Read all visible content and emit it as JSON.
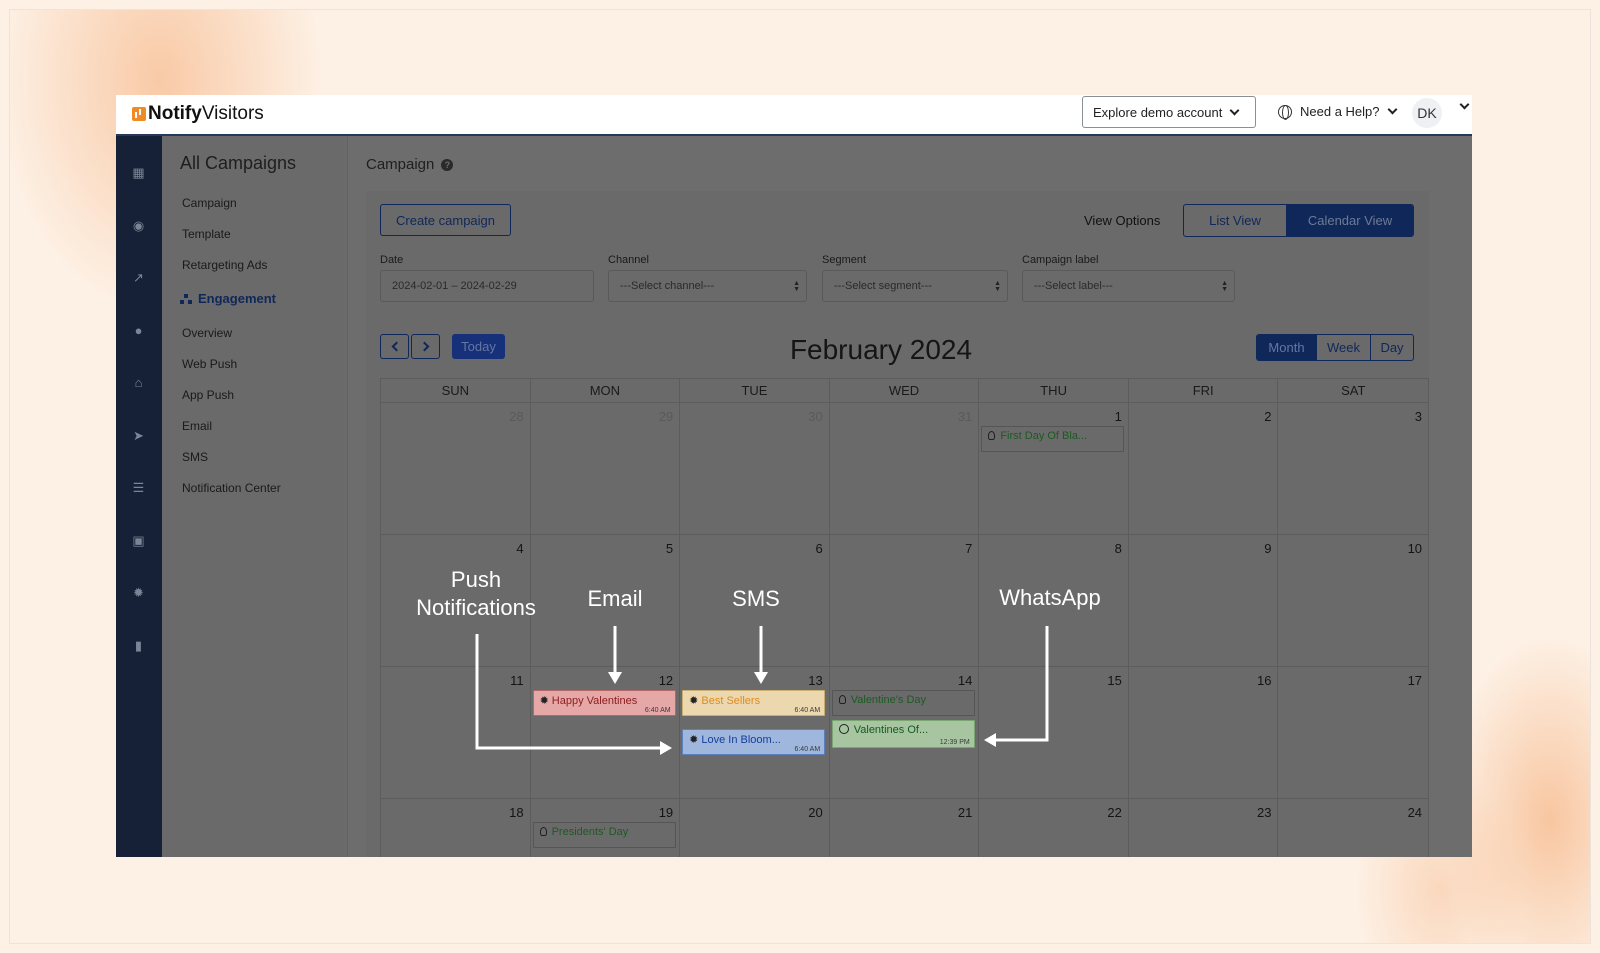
{
  "app": {
    "logo_bold": "Notify",
    "logo_regular": "Visitors"
  },
  "topbar": {
    "explore": "Explore demo account",
    "help": "Need a Help?",
    "avatar": "DK"
  },
  "sidebar": {
    "title": "All Campaigns",
    "items": [
      "Campaign",
      "Template",
      "Retargeting Ads"
    ],
    "section": "Engagement",
    "sub_items": [
      "Overview",
      "Web Push",
      "App Push",
      "Email",
      "SMS",
      "Notification Center"
    ]
  },
  "main": {
    "page_title": "Campaign",
    "create_button": "Create campaign",
    "view_options_label": "View Options",
    "list_view": "List View",
    "calendar_view": "Calendar View",
    "filters": {
      "date_label": "Date",
      "date_value": "2024-02-01 – 2024-02-29",
      "channel_label": "Channel",
      "channel_value": "---Select channel---",
      "segment_label": "Segment",
      "segment_value": "---Select segment---",
      "label_label": "Campaign label",
      "label_value": "---Select label---"
    },
    "today": "Today",
    "month_title": "February 2024",
    "modes": [
      "Month",
      "Week",
      "Day"
    ]
  },
  "calendar": {
    "weekdays": [
      "SUN",
      "MON",
      "TUE",
      "WED",
      "THU",
      "FRI",
      "SAT"
    ],
    "weeks": [
      [
        "28",
        "29",
        "30",
        "31",
        "1",
        "2",
        "3"
      ],
      [
        "4",
        "5",
        "6",
        "7",
        "8",
        "9",
        "10"
      ],
      [
        "11",
        "12",
        "13",
        "14",
        "15",
        "16",
        "17"
      ],
      [
        "18",
        "19",
        "20",
        "21",
        "22",
        "23",
        "24"
      ]
    ],
    "events": {
      "first_day": "First Day Of Bla...",
      "happy_valentines": "Happy Valentines",
      "happy_valentines_time": "6:40 AM",
      "best_sellers": "Best Sellers",
      "best_sellers_time": "6:40 AM",
      "love_in_bloom": "Love In Bloom...",
      "love_in_bloom_time": "6:40 AM",
      "valentines_day": "Valentine's Day",
      "valentines_of": "Valentines Of...",
      "valentines_of_time": "12:39 PM",
      "presidents_day": "Presidents' Day"
    }
  },
  "annotations": {
    "push_line1": "Push",
    "push_line2": "Notifications",
    "email": "Email",
    "sms": "SMS",
    "whatsapp": "WhatsApp"
  },
  "colors": {
    "brand_navy": "#10275a",
    "sidebar_dark": "#162036",
    "logo_orange": "#f08a24"
  }
}
